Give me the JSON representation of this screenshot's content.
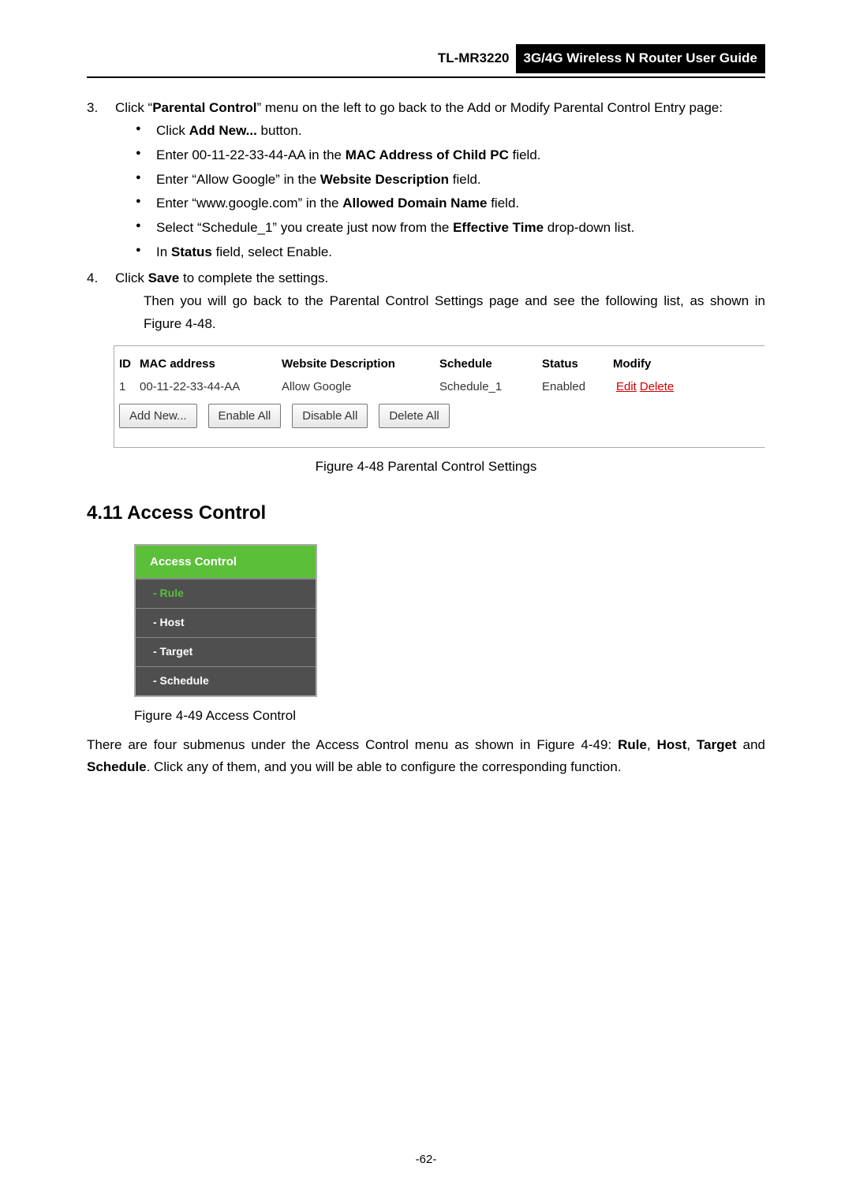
{
  "header": {
    "model": "TL-MR3220",
    "title": "3G/4G Wireless N Router User Guide"
  },
  "step3": {
    "num": "3.",
    "lead_a": "Click “",
    "lead_b": "Parental Control",
    "lead_c": "” menu on the left to go back to the Add or Modify Parental Control Entry page:",
    "bullets": [
      {
        "a": "Click ",
        "b": "Add New...",
        "c": " button."
      },
      {
        "a": "Enter 00-11-22-33-44-AA in the ",
        "b": "MAC Address of Child PC",
        "c": " field."
      },
      {
        "a": "Enter “Allow Google” in the ",
        "b": "Website Description",
        "c": " field."
      },
      {
        "a": "Enter “www.google.com” in the ",
        "b": "Allowed Domain Name",
        "c": " field."
      },
      {
        "a": "Select “Schedule_1” you create just now from the ",
        "b": "Effective Time",
        "c": " drop-down list."
      },
      {
        "a": "In ",
        "b": "Status",
        "c": " field, select Enable."
      }
    ]
  },
  "step4": {
    "num": "4.",
    "a": "Click ",
    "b": "Save",
    "c": " to complete the settings.",
    "then": "Then you will go back to the Parental Control Settings page and see the following list, as shown in Figure 4-48."
  },
  "table": {
    "headers": {
      "id": "ID",
      "mac": "MAC address",
      "desc": "Website Description",
      "sched": "Schedule",
      "status": "Status",
      "modify": "Modify"
    },
    "row": {
      "id": "1",
      "mac": "00-11-22-33-44-AA",
      "desc": "Allow Google",
      "sched": "Schedule_1",
      "status": "Enabled",
      "edit": "Edit",
      "delete": "Delete"
    },
    "buttons": {
      "add": "Add New...",
      "enable": "Enable All",
      "disable": "Disable All",
      "delete": "Delete All"
    }
  },
  "caption1": "Figure 4-48    Parental Control Settings",
  "section": {
    "heading": "4.11 Access Control"
  },
  "menu": {
    "head": "Access Control",
    "items": [
      "- Rule",
      "- Host",
      "- Target",
      "- Schedule"
    ]
  },
  "caption2": "Figure 4-49 Access Control",
  "para": {
    "a": "There are four submenus under the Access Control menu as shown in Figure 4-49: ",
    "b": "Rule",
    "c": ", ",
    "d": "Host",
    "e": ", ",
    "f": "Target",
    "g": " and ",
    "h": "Schedule",
    "i": ". Click any of them, and you will be able to configure the corresponding function."
  },
  "page": "-62-",
  "chart_data": {
    "type": "table",
    "title": "Parental Control Settings",
    "columns": [
      "ID",
      "MAC address",
      "Website Description",
      "Schedule",
      "Status",
      "Modify"
    ],
    "rows": [
      [
        "1",
        "00-11-22-33-44-AA",
        "Allow Google",
        "Schedule_1",
        "Enabled",
        "Edit / Delete"
      ]
    ]
  }
}
